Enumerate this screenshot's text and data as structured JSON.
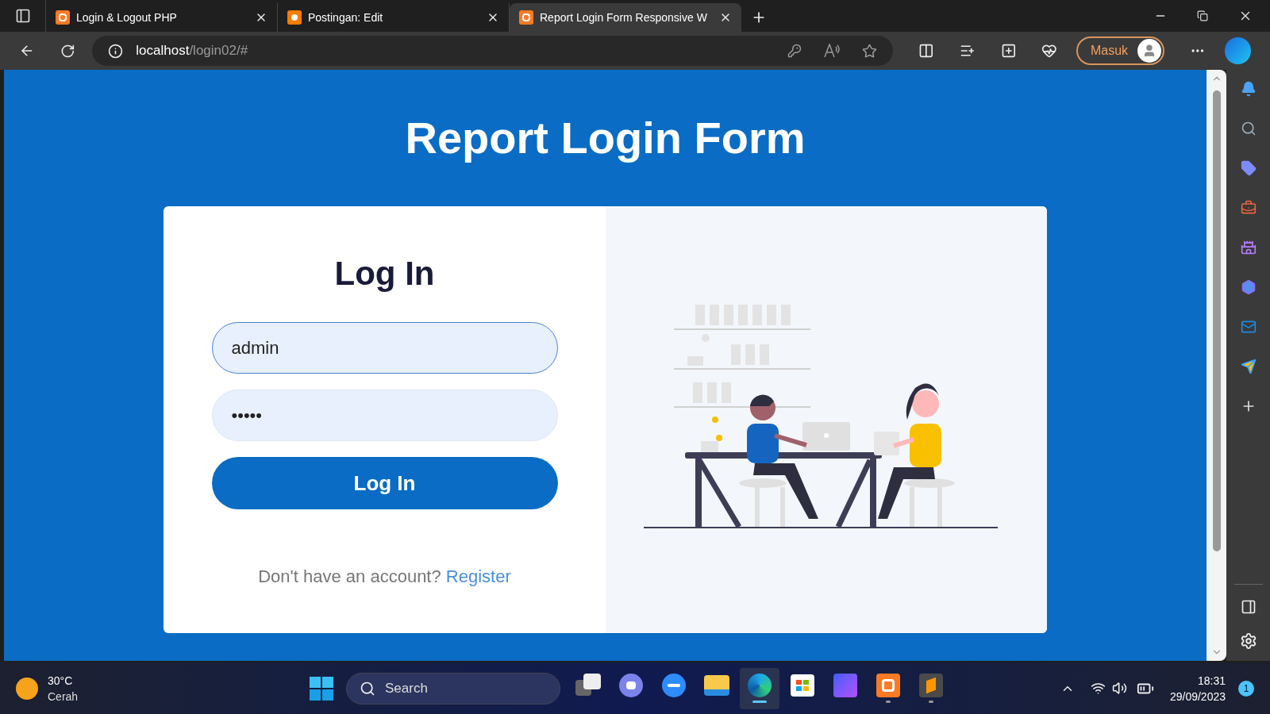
{
  "browser": {
    "tabs": [
      {
        "title": "Login & Logout PHP",
        "kind": "xampp",
        "selected": false
      },
      {
        "title": "Postingan: Edit",
        "kind": "blogger",
        "selected": false
      },
      {
        "title": "Report Login Form Responsive W",
        "kind": "xampp",
        "selected": true
      }
    ],
    "address": {
      "host": "localhost",
      "path": "/login02/#"
    },
    "profile_button": "Masuk"
  },
  "page": {
    "title": "Report Login Form",
    "form": {
      "heading": "Log In",
      "username": {
        "value": "admin",
        "focused": true
      },
      "password": {
        "value": "•••••",
        "focused": false
      },
      "submit": "Log In",
      "register_prompt": "Don't have an account?",
      "register_link": "Register"
    }
  },
  "taskbar": {
    "weather": {
      "temperature": "30°C",
      "condition": "Cerah"
    },
    "search_placeholder": "Search",
    "apps": [
      {
        "kind": "task-view",
        "running": false,
        "selected": false
      },
      {
        "kind": "chat",
        "running": false,
        "selected": false
      },
      {
        "kind": "zoom",
        "running": false,
        "selected": false
      },
      {
        "kind": "files",
        "running": false,
        "selected": false
      },
      {
        "kind": "edge",
        "running": true,
        "selected": true
      },
      {
        "kind": "store",
        "running": false,
        "selected": false
      },
      {
        "kind": "editor",
        "running": false,
        "selected": false
      },
      {
        "kind": "xampp",
        "running": true,
        "selected": false
      },
      {
        "kind": "sublime",
        "running": true,
        "selected": false
      }
    ],
    "time": "18:31",
    "date": "29/09/2023",
    "notification_count": "1"
  }
}
